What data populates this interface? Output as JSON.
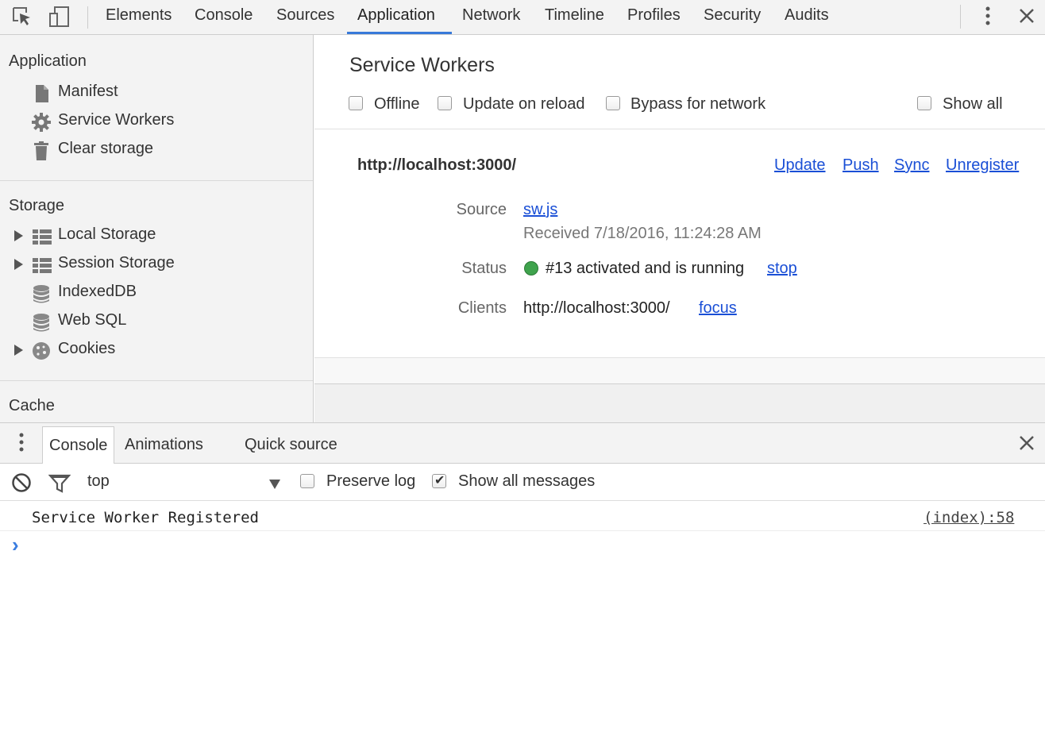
{
  "toolbar": {
    "tabs": [
      {
        "label": "Elements"
      },
      {
        "label": "Console"
      },
      {
        "label": "Sources"
      },
      {
        "label": "Application"
      },
      {
        "label": "Network"
      },
      {
        "label": "Timeline"
      },
      {
        "label": "Profiles"
      },
      {
        "label": "Security"
      },
      {
        "label": "Audits"
      }
    ],
    "active_tab": "Application"
  },
  "sidebar": {
    "application_header": "Application",
    "application_items": [
      {
        "label": "Manifest",
        "icon": "document-icon"
      },
      {
        "label": "Service Workers",
        "icon": "gear-icon"
      },
      {
        "label": "Clear storage",
        "icon": "trash-icon"
      }
    ],
    "storage_header": "Storage",
    "storage_items": [
      {
        "label": "Local Storage",
        "icon": "grid-icon",
        "expandable": true
      },
      {
        "label": "Session Storage",
        "icon": "grid-icon",
        "expandable": true
      },
      {
        "label": "IndexedDB",
        "icon": "database-icon",
        "expandable": false
      },
      {
        "label": "Web SQL",
        "icon": "database-icon",
        "expandable": false
      },
      {
        "label": "Cookies",
        "icon": "cookie-icon",
        "expandable": true
      }
    ],
    "cache_header": "Cache"
  },
  "main": {
    "title": "Service Workers",
    "options": {
      "offline": "Offline",
      "update_on_reload": "Update on reload",
      "bypass_for_network": "Bypass for network",
      "show_all": "Show all"
    },
    "worker": {
      "scope": "http://localhost:3000/",
      "actions": {
        "update": "Update",
        "push": "Push",
        "sync": "Sync",
        "unregister": "Unregister"
      },
      "source_label": "Source",
      "source_file": "sw.js",
      "received": "Received 7/18/2016, 11:24:28 AM",
      "status_label": "Status",
      "status_text": "#13 activated and is running",
      "status_color": "#3fa34d",
      "stop_link": "stop",
      "clients_label": "Clients",
      "client_url": "http://localhost:3000/",
      "focus_link": "focus"
    }
  },
  "drawer": {
    "tabs": [
      {
        "label": "Console"
      },
      {
        "label": "Animations"
      },
      {
        "label": "Quick source"
      }
    ],
    "context": "top",
    "preserve_log": "Preserve log",
    "show_all_messages": "Show all messages",
    "show_all_checked": true,
    "messages": [
      {
        "text": "Service Worker Registered",
        "source": "(index):58"
      }
    ],
    "prompt": "›"
  }
}
